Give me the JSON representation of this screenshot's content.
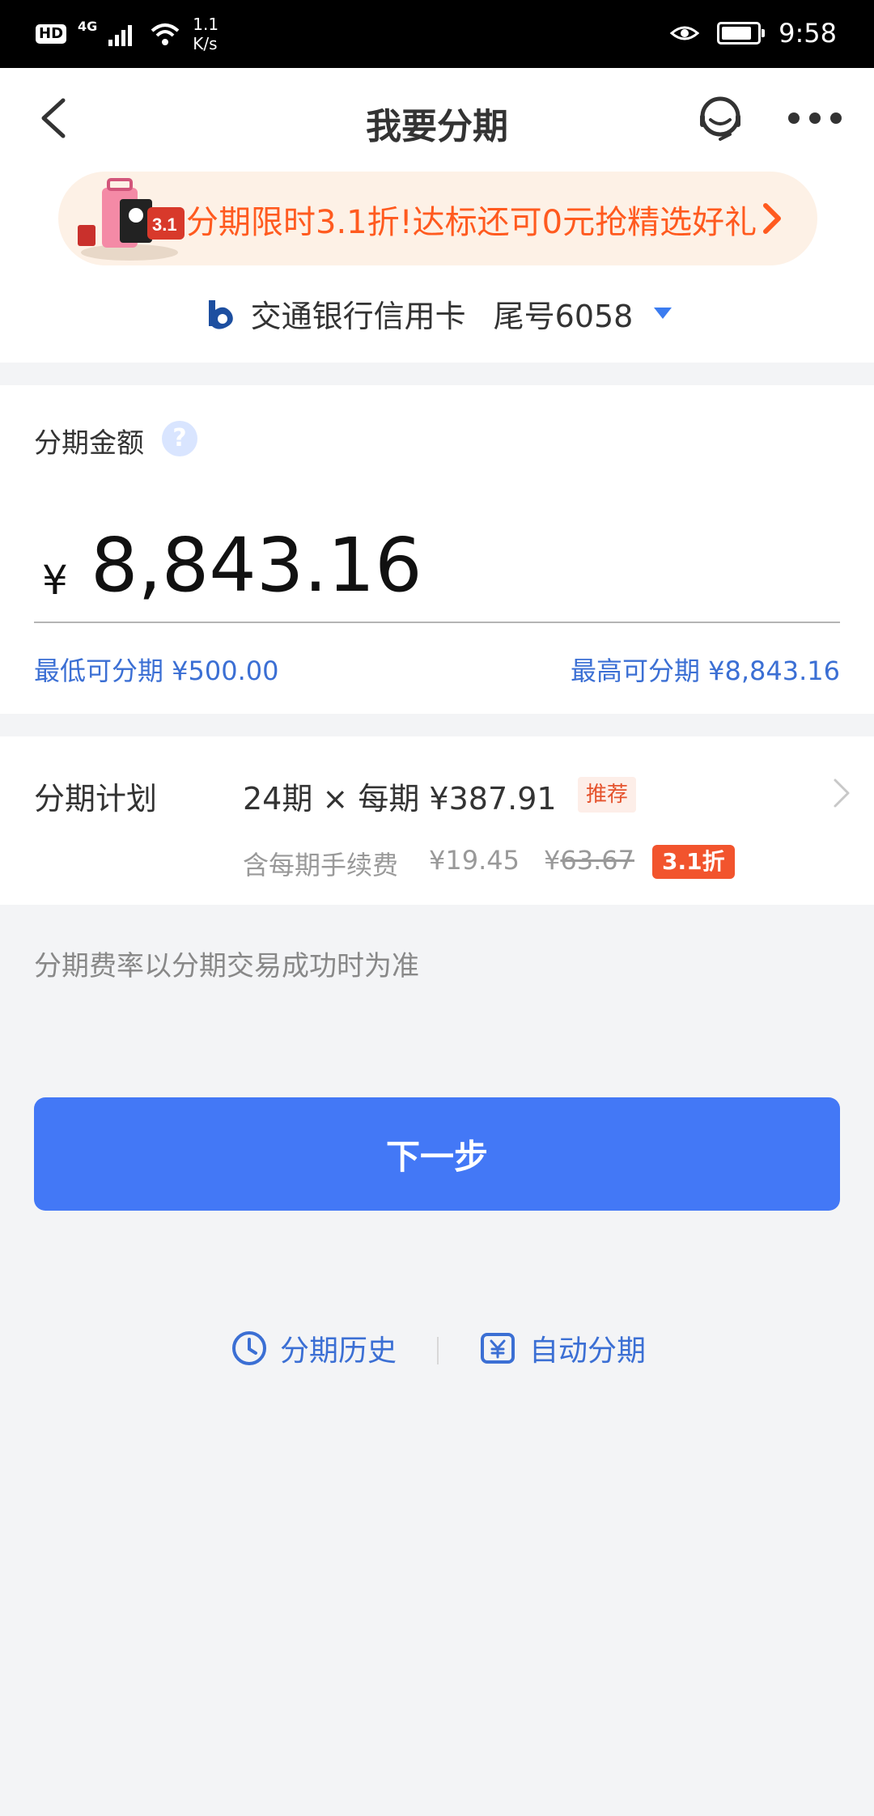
{
  "status_bar": {
    "hd": "HD",
    "network": "4G",
    "speed_value": "1.1",
    "speed_unit": "K/s",
    "time": "9:58"
  },
  "nav": {
    "title": "我要分期"
  },
  "promo": {
    "text": "分期限时3.1折!达标还可0元抢精选好礼"
  },
  "card": {
    "name": "交通银行信用卡",
    "tail": "尾号6058"
  },
  "amount": {
    "label": "分期金额",
    "help": "?",
    "currency": "¥",
    "value": "8,843.16",
    "min_label": "最低可分期 ¥500.00",
    "max_label": "最高可分期 ¥8,843.16"
  },
  "plan": {
    "label": "分期计划",
    "summary": "24期 × 每期 ¥387.91",
    "badge": "推荐",
    "fee_label": "含每期手续费",
    "fee_value": "¥19.45",
    "fee_orig_prefix": "¥",
    "fee_orig": "63.67",
    "discount": "3.1折"
  },
  "note": "分期费率以分期交易成功时为准",
  "next_button": "下一步",
  "links": {
    "history": "分期历史",
    "auto": "自动分期"
  },
  "colors": {
    "primary": "#4378f6",
    "link": "#3b6fd4",
    "promo_orange": "#ff5a1f",
    "discount_red": "#f2542d"
  }
}
